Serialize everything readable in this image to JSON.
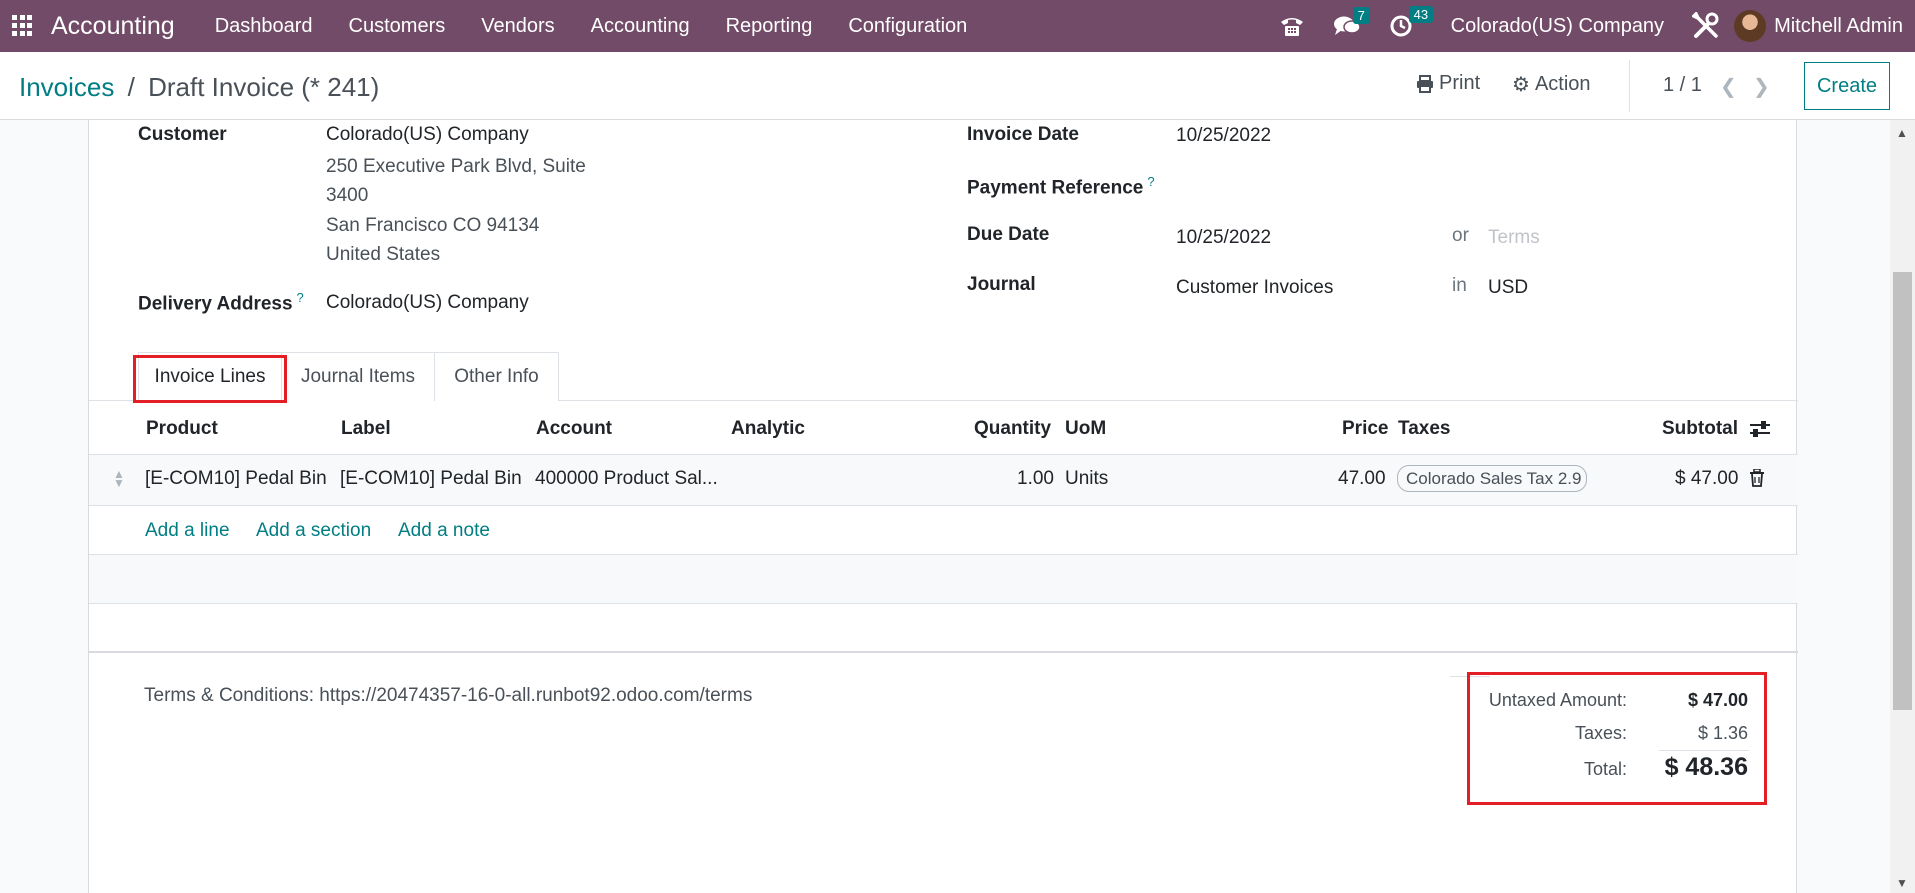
{
  "navbar": {
    "brand": "Accounting",
    "menu": [
      "Dashboard",
      "Customers",
      "Vendors",
      "Accounting",
      "Reporting",
      "Configuration"
    ],
    "messages_count": "7",
    "activities_count": "43",
    "company": "Colorado(US) Company",
    "user": "Mitchell Admin",
    "color": "#714b67"
  },
  "control": {
    "breadcrumb_parent": "Invoices",
    "breadcrumb_sep": "/",
    "breadcrumb_current": "Draft Invoice (* 241)",
    "print_label": "Print",
    "action_label": "Action",
    "pager": "1 / 1",
    "create_label": "Create"
  },
  "form": {
    "customer_label": "Customer",
    "customer_name": "Colorado(US) Company",
    "address_line1": "250 Executive Park Blvd, Suite",
    "address_line2": "3400",
    "address_line3": "San Francisco CO 94134",
    "address_line4": "United States",
    "delivery_label": "Delivery Address",
    "delivery_value": "Colorado(US) Company",
    "invoice_date_label": "Invoice Date",
    "invoice_date": "10/25/2022",
    "payment_ref_label": "Payment Reference",
    "due_date_label": "Due Date",
    "due_date": "10/25/2022",
    "or_label": "or",
    "terms_placeholder": "Terms",
    "journal_label": "Journal",
    "journal_value": "Customer Invoices",
    "in_label": "in",
    "currency": "USD",
    "help_mark": "?"
  },
  "tabs": [
    {
      "label": "Invoice Lines"
    },
    {
      "label": "Journal Items"
    },
    {
      "label": "Other Info"
    }
  ],
  "table": {
    "headers": {
      "product": "Product",
      "label": "Label",
      "account": "Account",
      "analytic": "Analytic",
      "quantity": "Quantity",
      "uom": "UoM",
      "price": "Price",
      "taxes": "Taxes",
      "subtotal": "Subtotal"
    },
    "rows": [
      {
        "product": "[E-COM10] Pedal Bin",
        "label": "[E-COM10] Pedal Bin",
        "account": "400000 Product Sal...",
        "quantity": "1.00",
        "uom": "Units",
        "price": "47.00",
        "taxes": "Colorado Sales Tax 2.9",
        "subtotal": "$ 47.00"
      }
    ],
    "add_line": "Add a line",
    "add_section": "Add a section",
    "add_note": "Add a note"
  },
  "footer": {
    "terms": "Terms & Conditions: https://20474357-16-0-all.runbot92.odoo.com/terms",
    "untaxed_label": "Untaxed Amount:",
    "untaxed_value": "$ 47.00",
    "taxes_label": "Taxes:",
    "taxes_value": "$ 1.36",
    "total_label": "Total:",
    "total_value": "$ 48.36"
  }
}
